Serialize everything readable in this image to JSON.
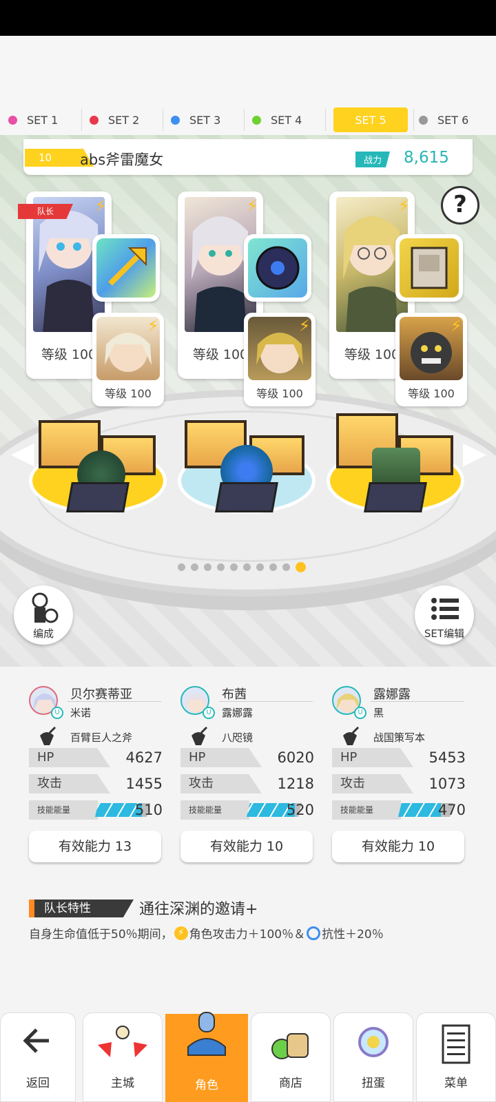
{
  "set_tabs": [
    {
      "label": "SET 1",
      "color": "#e94fa6"
    },
    {
      "label": "SET 2",
      "color": "#e8394b"
    },
    {
      "label": "SET 3",
      "color": "#3d8ef0"
    },
    {
      "label": "SET 4",
      "color": "#6ed12f"
    },
    {
      "label": "SET 5",
      "color": "#ffd21f",
      "active": true
    },
    {
      "label": "SET 6",
      "color": "#999999"
    }
  ],
  "team": {
    "number": "10",
    "name": "abs斧雷魔女",
    "power_label": "战力",
    "power_value": "8,615"
  },
  "help_label": "?",
  "leader_flag": "队长",
  "characters": [
    {
      "level": "等级 100",
      "sub_level": "等级 100"
    },
    {
      "level": "等级 100",
      "sub_level": "等级 100"
    },
    {
      "level": "等级 100",
      "sub_level": "等级 100"
    }
  ],
  "left_button_label": "编成",
  "right_button_label": "SET编辑",
  "pager_total": 10,
  "pager_active": 10,
  "members": [
    {
      "name": "贝尔赛蒂亚",
      "partner": "米诺",
      "weapon": "百臂巨人之斧",
      "hp_label": "HP",
      "hp": "4627",
      "atk_label": "攻击",
      "atk": "1455",
      "energy_label": "技能能量",
      "energy": "510",
      "energy_fill": 0.85,
      "effective": "有效能力 13"
    },
    {
      "name": "布茜",
      "partner": "露娜露",
      "weapon": "八咫镜",
      "hp_label": "HP",
      "hp": "6020",
      "atk_label": "攻击",
      "atk": "1218",
      "energy_label": "技能能量",
      "energy": "520",
      "energy_fill": 0.87,
      "effective": "有效能力 10"
    },
    {
      "name": "露娜露",
      "partner": "黑",
      "weapon": "战国策写本",
      "hp_label": "HP",
      "hp": "5453",
      "atk_label": "攻击",
      "atk": "1073",
      "energy_label": "技能能量",
      "energy": "470",
      "energy_fill": 0.78,
      "effective": "有效能力 10"
    }
  ],
  "leader_trait": {
    "label": "队长特性",
    "name": "通往深渊的邀请+",
    "desc_part1": "自身生命值低于50％期间，",
    "desc_part2": "角色攻击力＋100％＆",
    "desc_part3": "抗性＋20％"
  },
  "nav": [
    {
      "label": "返回",
      "icon": "back-arrow-icon"
    },
    {
      "label": "主城",
      "icon": "castle-icon"
    },
    {
      "label": "角色",
      "icon": "character-icon",
      "active": true
    },
    {
      "label": "商店",
      "icon": "shop-icon"
    },
    {
      "label": "扭蛋",
      "icon": "gacha-icon"
    },
    {
      "label": "菜单",
      "icon": "menu-icon"
    }
  ]
}
